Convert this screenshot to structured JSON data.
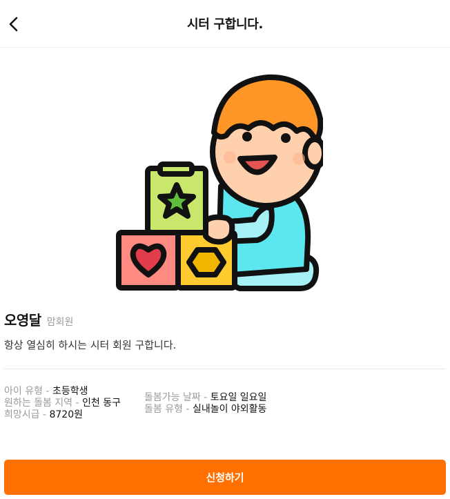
{
  "header": {
    "title": "시터 구합니다.",
    "back_icon": "chevron-left-icon"
  },
  "hero": {
    "illustration": "baby-with-toy-blocks-illustration"
  },
  "profile": {
    "name": "오영달",
    "member_type": "맘회원"
  },
  "description": "항상 열심히 하시는 시터 회원 구합니다.",
  "info_left": [
    {
      "label": "아이 유형",
      "value": "초등학생"
    },
    {
      "label": "원하는 돌봄 지역",
      "value": "인천 동구"
    },
    {
      "label": "희망시급",
      "value": "8720원"
    }
  ],
  "info_right": [
    {
      "label": "돌봄가능 날짜",
      "value": "토요일 일요일"
    },
    {
      "label": "돌봄 유형",
      "value": "실내놀이 야외활동"
    }
  ],
  "separator": " - ",
  "apply_button": {
    "label": "신청하기"
  },
  "colors": {
    "accent": "#ff7000",
    "label_gray": "#9a9a9a",
    "divider": "#e8e8e8"
  }
}
